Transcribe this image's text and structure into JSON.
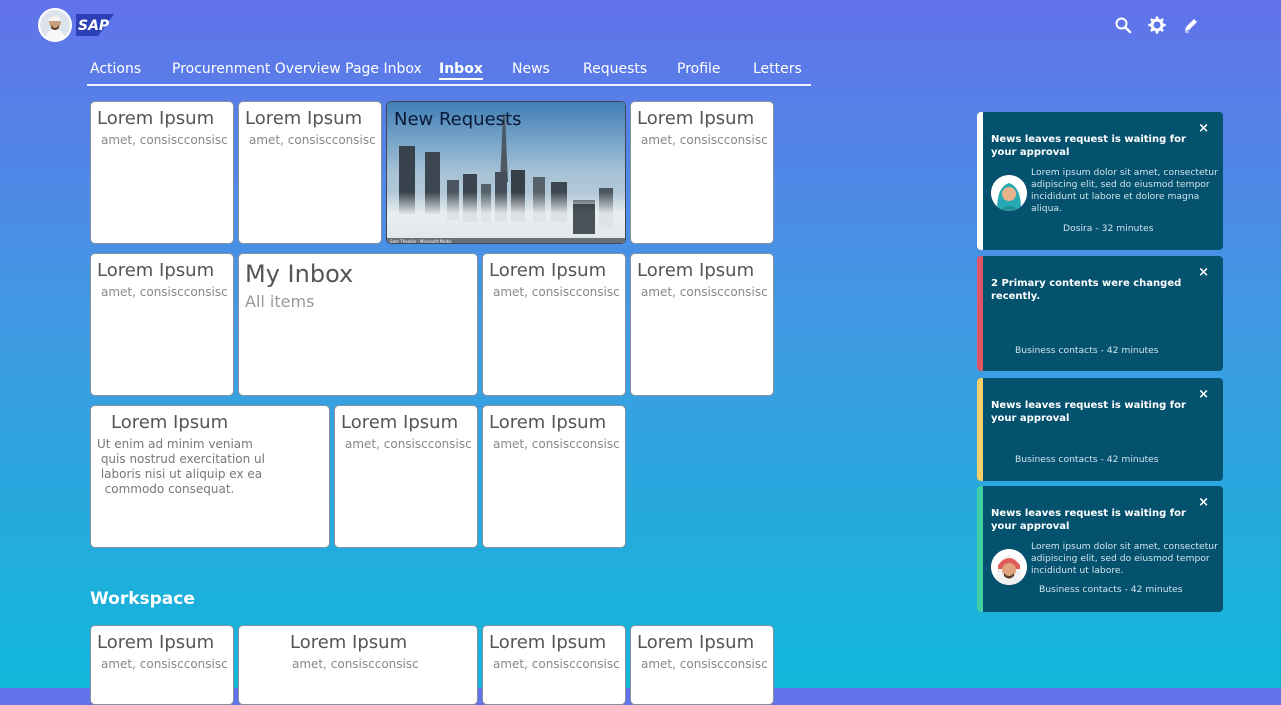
{
  "header": {
    "logo_text": "SAP",
    "icons": [
      "search-icon",
      "gear-icon",
      "edit-icon"
    ]
  },
  "tabs": [
    {
      "label": "Actions"
    },
    {
      "label": "Procurenment Overview Page Inbox"
    },
    {
      "label": "Inbox",
      "active": true
    },
    {
      "label": "News"
    },
    {
      "label": "Requests"
    },
    {
      "label": "Profile"
    },
    {
      "label": "Letters"
    }
  ],
  "tiles": {
    "r1c1": {
      "title": "Lorem Ipsum",
      "subtitle": "amet, consiscconsisc"
    },
    "r1c2": {
      "title": "Lorem Ipsum",
      "subtitle": "amet, consiscconsisc"
    },
    "r1c3": {
      "title": "New Requests",
      "image_credit": "Sam Theedin · Microsoft Media"
    },
    "r1c4": {
      "title": "Lorem Ipsum",
      "subtitle": "amet, consiscconsisc"
    },
    "r2c1": {
      "title": "Lorem Ipsum",
      "subtitle": "amet, consiscconsisc"
    },
    "r2c2": {
      "title": "My Inbox",
      "subtitle": "All items"
    },
    "r2c3": {
      "title": "Lorem Ipsum",
      "subtitle": "amet, consiscconsisc"
    },
    "r2c4": {
      "title": "Lorem Ipsum",
      "subtitle": "amet, consiscconsisc"
    },
    "r3c1": {
      "title": "Lorem Ipsum",
      "body": "Ut enim ad minim veniam\n quis nostrud exercitation ul\n laboris nisi ut aliquip ex ea\n  commodo consequat."
    },
    "r3c2": {
      "title": "Lorem Ipsum",
      "subtitle": "amet, consiscconsisc"
    },
    "r3c3": {
      "title": "Lorem Ipsum",
      "subtitle": "amet, consiscconsisc"
    }
  },
  "workspace": {
    "title": "Workspace",
    "tiles": [
      {
        "title": "Lorem Ipsum",
        "subtitle": "amet, consiscconsisc"
      },
      {
        "title": "Lorem Ipsum",
        "subtitle": "amet, consiscconsisc"
      },
      {
        "title": "Lorem Ipsum",
        "subtitle": "amet, consiscconsisc"
      },
      {
        "title": "Lorem Ipsum",
        "subtitle": "amet, consiscconsisc"
      }
    ]
  },
  "notifications": [
    {
      "title": "News leaves request is waiting for your approval",
      "body": "Lorem ipsum dolor sit amet, consectetur adipiscing elit, sed do eiusmod tempor incididunt ut labore et dolore magna aliqua.",
      "footer": "Dosira - 32 minutes",
      "stripe_color": "#ffffff",
      "close": "×"
    },
    {
      "title": "2 Primary contents were changed recently.",
      "footer": "Business contacts - 42 minutes",
      "stripe_color": "#e05565",
      "close": "×"
    },
    {
      "title": "News leaves request is waiting for your approval",
      "footer": "Business contacts - 42 minutes",
      "stripe_color": "#f3d06b",
      "close": "×"
    },
    {
      "title": "News leaves request is waiting for your approval",
      "body": "Lorem ipsum dolor sit amet, consectetur adipiscing elit, sed do eiusmod tempor incididunt ut labore.",
      "footer": "Business contacts - 42 minutes",
      "stripe_color": "#3fd1a5",
      "close": "×"
    }
  ],
  "colors": {
    "notification_bg": "#05526f",
    "gradient_top": "#6272ea",
    "gradient_bottom": "#10b7d9"
  }
}
